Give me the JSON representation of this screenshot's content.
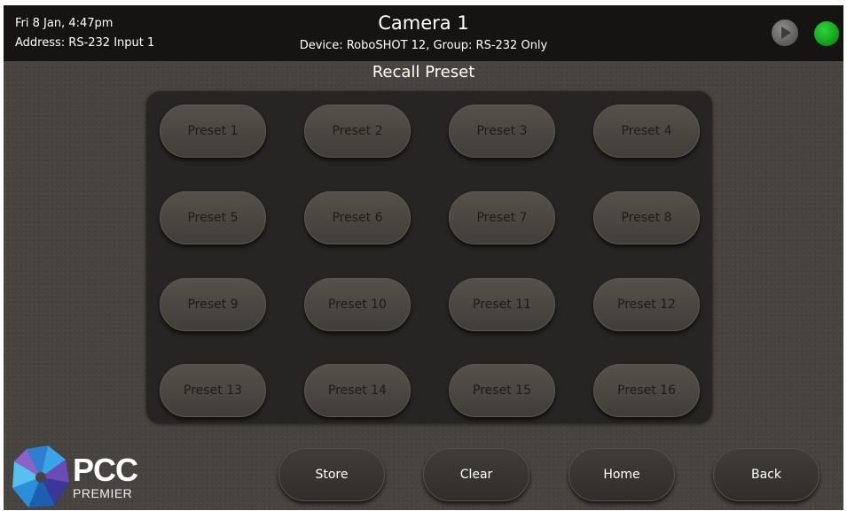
{
  "header": {
    "datetime": "Fri 8 Jan, 4:47pm",
    "address": "Address: RS-232 Input 1",
    "title": "Camera 1",
    "subtitle": "Device: RoboSHOT 12, Group: RS-232 Only",
    "status_indicators": [
      {
        "name": "play-status",
        "icon": "play-icon",
        "color": "#7a7a7a"
      },
      {
        "name": "connection-status",
        "color": "#18b824"
      }
    ]
  },
  "section_title": "Recall Preset",
  "presets": [
    "Preset 1",
    "Preset 2",
    "Preset 3",
    "Preset 4",
    "Preset 5",
    "Preset 6",
    "Preset 7",
    "Preset 8",
    "Preset 9",
    "Preset 10",
    "Preset 11",
    "Preset 12",
    "Preset 13",
    "Preset 14",
    "Preset 15",
    "Preset 16"
  ],
  "actions": {
    "store": "Store",
    "clear": "Clear",
    "home": "Home",
    "back": "Back"
  },
  "logo": {
    "main": "PCC",
    "sub": "PREMIER"
  },
  "colors": {
    "background": "#47443f",
    "topbar": "#151413",
    "panel": "#262523",
    "status_green": "#18b824"
  }
}
